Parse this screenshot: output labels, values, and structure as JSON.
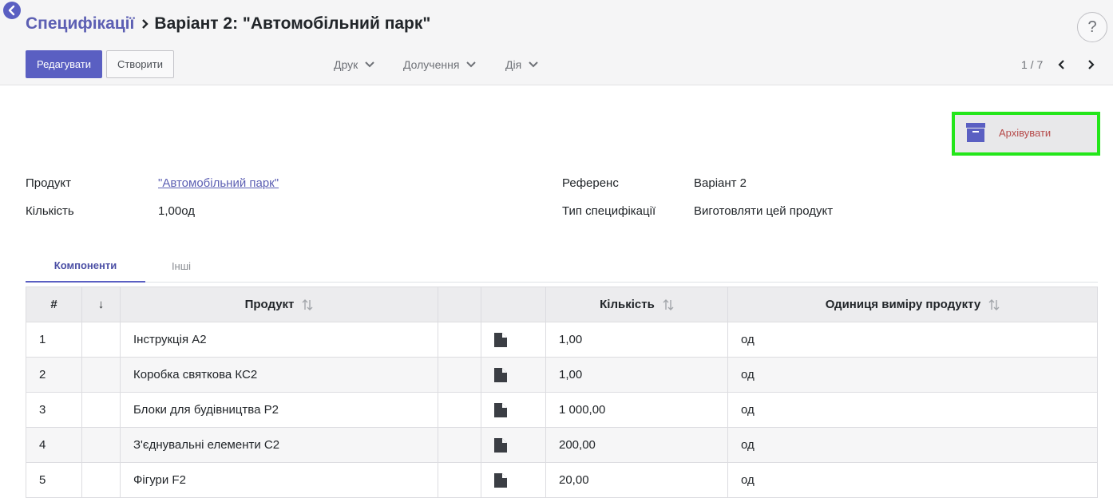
{
  "breadcrumb": {
    "parent": "Специфікації",
    "current": "Варіант 2: \"Автомобільний парк\""
  },
  "help": {
    "label": "?"
  },
  "toolbar": {
    "edit_label": "Редагувати",
    "create_label": "Створити",
    "print_label": "Друк",
    "attach_label": "Долучення",
    "action_label": "Дія"
  },
  "pager": {
    "value": "1 / 7"
  },
  "archive": {
    "label": "Архівувати"
  },
  "form": {
    "product_label": "Продукт",
    "product_value": "\"Автомобільний парк\"",
    "quantity_label": "Кількість",
    "quantity_value": "1,00од",
    "reference_label": "Референс",
    "reference_value": "Варіант 2",
    "bom_type_label": "Тип специфікації",
    "bom_type_value": "Виготовляти цей продукт"
  },
  "tabs": {
    "components": "Компоненти",
    "other": "Інші"
  },
  "table": {
    "headers": {
      "index": "#",
      "sequence": "↓",
      "product": "Продукт",
      "quantity": "Кількість",
      "uom": "Одиниця виміру продукту"
    },
    "rows": [
      {
        "index": "1",
        "product": "Інструкція А2",
        "quantity": "1,00",
        "uom": "од"
      },
      {
        "index": "2",
        "product": "Коробка святкова КС2",
        "quantity": "1,00",
        "uom": "од"
      },
      {
        "index": "3",
        "product": "Блоки для будівництва Р2",
        "quantity": "1 000,00",
        "uom": "од"
      },
      {
        "index": "4",
        "product": "З'єднувальні елементи С2",
        "quantity": "200,00",
        "uom": "од"
      },
      {
        "index": "5",
        "product": "Фігури F2",
        "quantity": "20,00",
        "uom": "од"
      }
    ]
  },
  "colors": {
    "primary": "#5a5fc2",
    "archive_highlight": "#23e61a",
    "archive_text": "#b64b4b"
  }
}
